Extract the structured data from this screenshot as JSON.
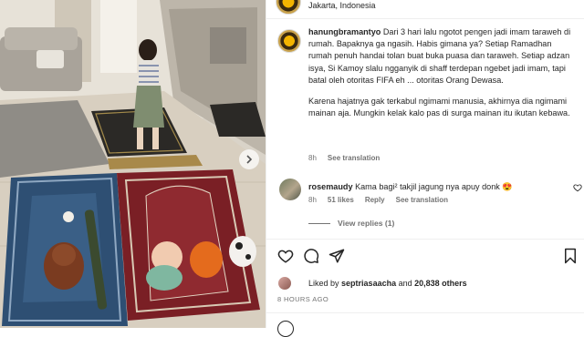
{
  "post": {
    "location": "Jakarta, Indonesia",
    "caption": {
      "username": "hanungbramantyo",
      "paragraph1": "Dari 3 hari lalu ngotot pengen jadi imam taraweh di rumah. Bapaknya ga ngasih. Habis gimana ya? Setiap Ramadhan rumah penuh handai tolan buat buka puasa dan taraweh. Setiap adzan isya, Si Kamoy slalu ngganyik di shaff terdepan ngebet jadi imam, tapi batal oleh otoritas FIFA eh ... otoritas Orang Dewasa.",
      "paragraph2": "Karena hajatnya gak terkabul ngimami manusia, akhirnya dia ngimami mainan aja. Mungkin kelak kalo pas di surga mainan itu ikutan kebawa.",
      "time": "8h",
      "see_translation": "See translation"
    },
    "comments": [
      {
        "username": "rosemaudy",
        "text": "Kama bagi² takjil jagung nya apuy donk 😍",
        "time": "8h",
        "likes": "51 likes",
        "reply": "Reply",
        "see_translation": "See translation",
        "view_replies": "View replies (1)"
      }
    ],
    "likes": {
      "prefix": "Liked by ",
      "user": "septriasaacha",
      "middle": " and ",
      "others": "20,838 others"
    },
    "timestamp": "8 HOURS AGO"
  },
  "icons": {
    "like": "heart-icon",
    "comment": "comment-icon",
    "share": "share-icon",
    "save": "bookmark-icon",
    "next": "chevron-right-icon"
  },
  "colors": {
    "text": "#262626",
    "muted": "#737373",
    "divider": "#efefef"
  }
}
